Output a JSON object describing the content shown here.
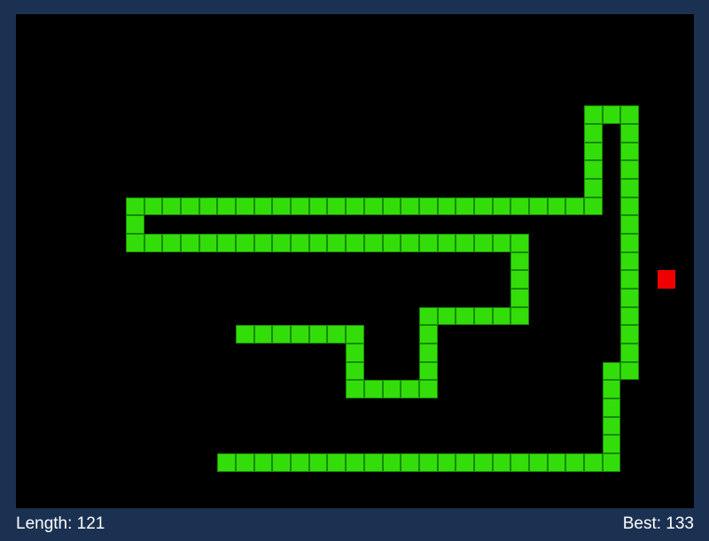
{
  "game": {
    "title": "",
    "colors": {
      "background": "#1b3152",
      "board": "#000000",
      "snake": "#33dd0a",
      "snake_outline": "#178a05",
      "food": "#ee0000",
      "text": "#ffffff"
    },
    "grid": {
      "columns": 37,
      "rows": 27
    },
    "snake_path": [
      [
        11,
        24
      ],
      [
        32,
        24
      ],
      [
        32,
        19
      ],
      [
        33,
        19
      ],
      [
        33,
        5
      ],
      [
        31,
        5
      ],
      [
        31,
        10
      ],
      [
        6,
        10
      ],
      [
        6,
        12
      ],
      [
        27,
        12
      ],
      [
        27,
        16
      ],
      [
        22,
        16
      ],
      [
        22,
        20
      ],
      [
        18,
        20
      ],
      [
        18,
        17
      ],
      [
        12,
        17
      ]
    ],
    "food": {
      "col": 35,
      "row": 14
    }
  },
  "status": {
    "length_text": "Length: 121",
    "best_text": "Best: 133"
  }
}
